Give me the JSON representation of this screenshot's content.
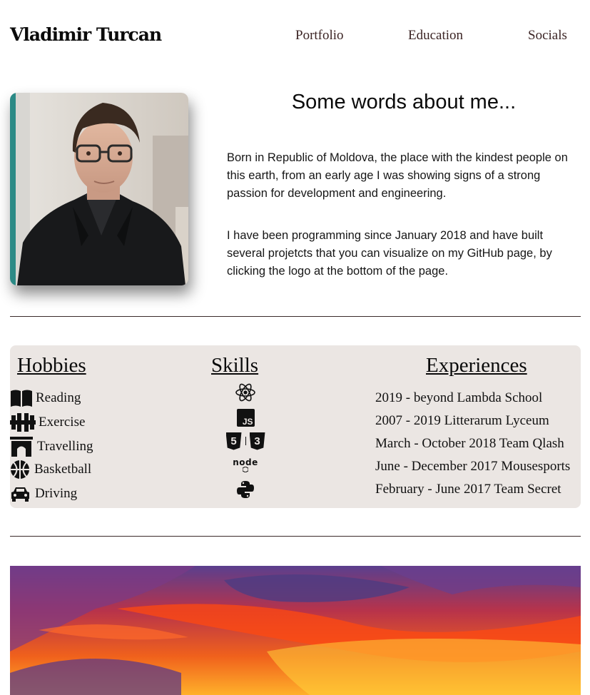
{
  "header": {
    "brand": "Vladimir Turcan",
    "nav": [
      "Portfolio",
      "Education",
      "Socials"
    ]
  },
  "about": {
    "title": "Some words about me...",
    "paragraphs": [
      "Born in Republic of Moldova, the place with the kindest people on this earth, from an early age I was showing signs of a strong passion for development and engineering.",
      "I have been programming since January 2018 and have built several projetcts that you can visualize on my GitHub page, by clicking the logo at the bottom of the page."
    ]
  },
  "hobbies": {
    "title": "Hobbies",
    "items": [
      {
        "label": "Reading",
        "icon": "book-icon"
      },
      {
        "label": "Exercise",
        "icon": "dumbbell-icon"
      },
      {
        "label": "Travelling",
        "icon": "archway-icon"
      },
      {
        "label": "Basketball",
        "icon": "basketball-icon"
      },
      {
        "label": "Driving",
        "icon": "car-icon"
      }
    ]
  },
  "skills": {
    "title": "Skills",
    "items": [
      {
        "icon": "react-icon"
      },
      {
        "icon": "javascript-icon",
        "label": "JS"
      },
      {
        "icon": "html5-css3-icon",
        "label": "5",
        "label2": "3"
      },
      {
        "icon": "nodejs-icon",
        "label": "node"
      },
      {
        "icon": "python-icon"
      }
    ]
  },
  "experiences": {
    "title": "Experiences",
    "items": [
      "2019 - beyond Lambda School",
      "2007 - 2019 Litterarum Lyceum",
      "March - October 2018 Team Qlash",
      "June - December 2017 Mousesports",
      "February - June 2017 Team Secret"
    ]
  },
  "colors": {
    "panel_bg": "#ebe6e3",
    "nav_text": "#3b2424",
    "rule": "#3a2a2a"
  }
}
